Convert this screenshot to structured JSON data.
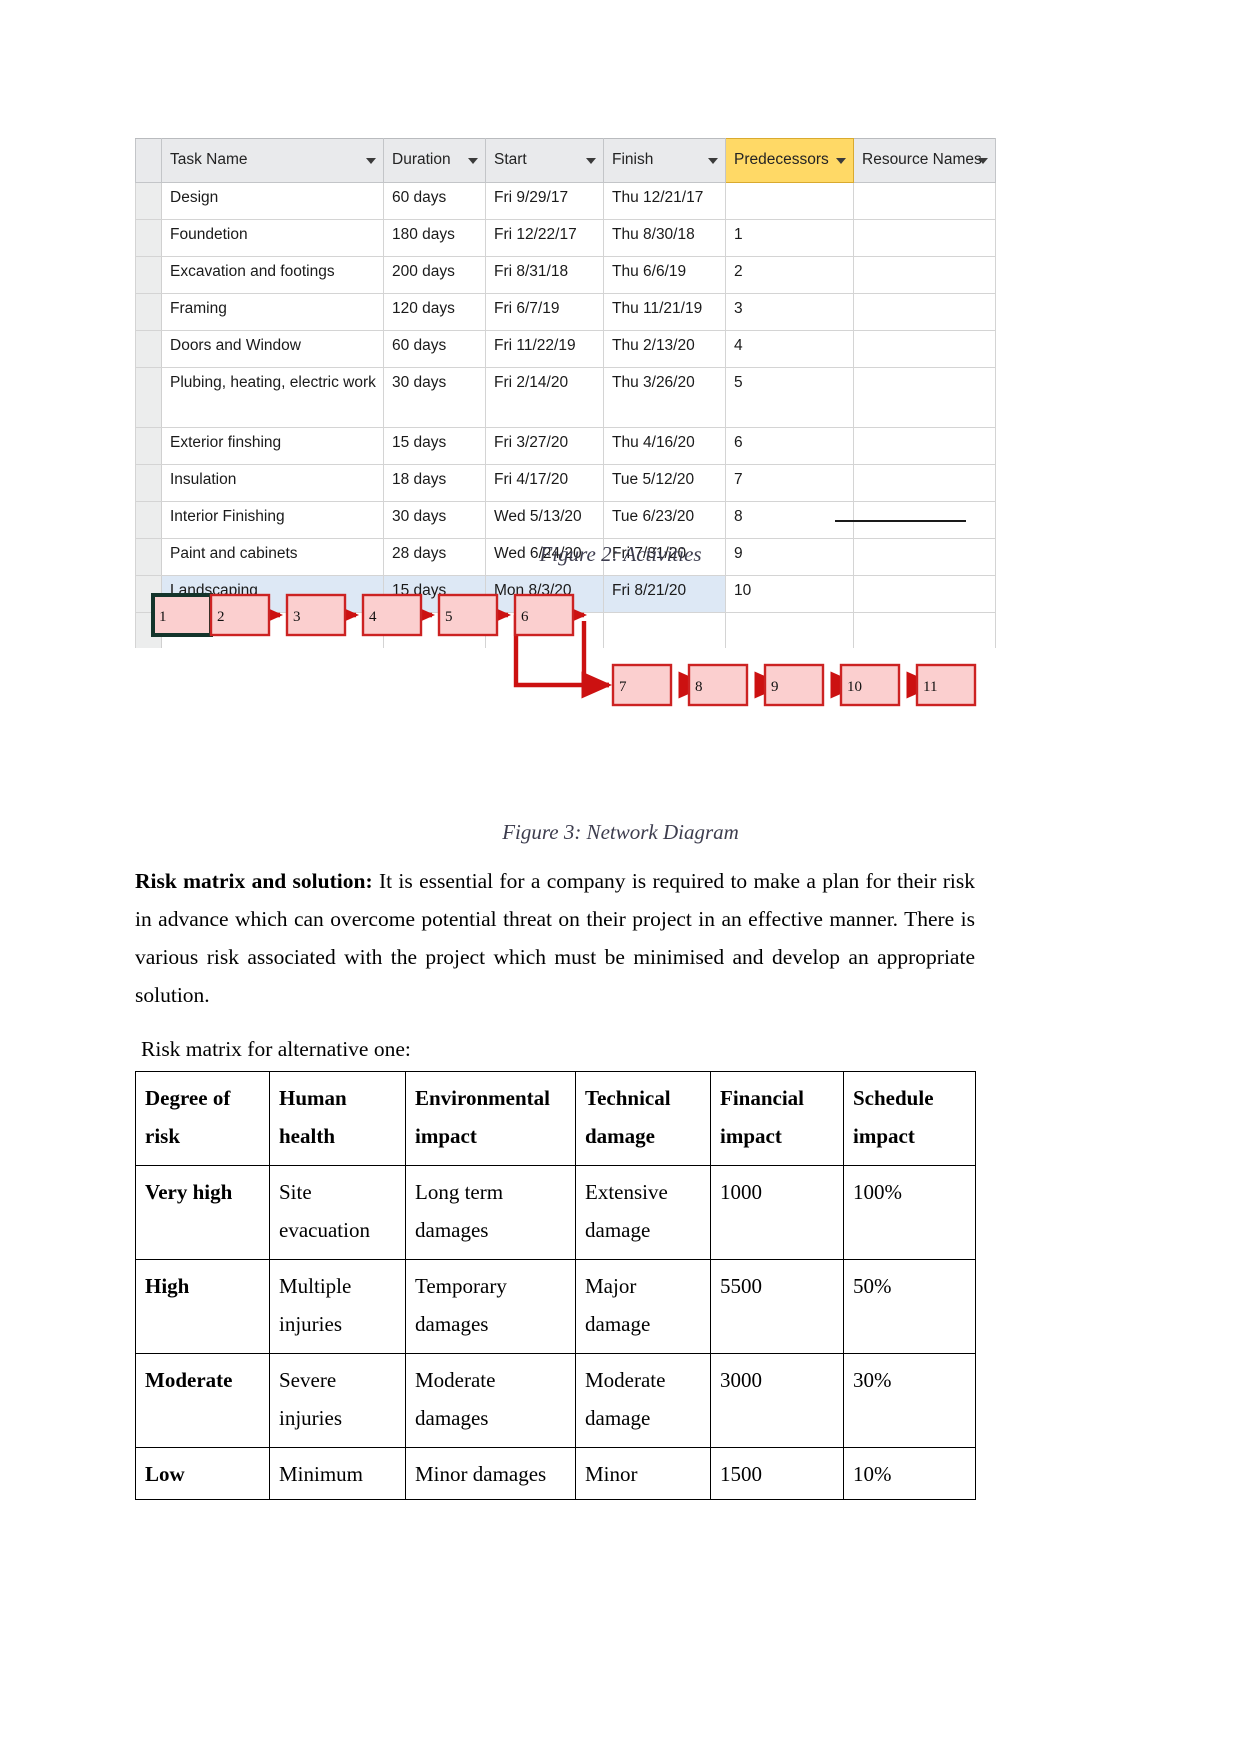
{
  "project_table": {
    "columns": [
      "Task Name",
      "Duration",
      "Start",
      "Finish",
      "Predecessors",
      "Resource Names"
    ],
    "highlight_column": "Predecessors",
    "highlight_color": "#ffd966",
    "rows": [
      {
        "task": "Design",
        "duration": "60 days",
        "start": "Fri 9/29/17",
        "finish": "Thu 12/21/17",
        "predecessors": "",
        "resources": ""
      },
      {
        "task": "Foundetion",
        "duration": "180 days",
        "start": "Fri 12/22/17",
        "finish": "Thu 8/30/18",
        "predecessors": "1",
        "resources": ""
      },
      {
        "task": "Excavation and footings",
        "duration": "200 days",
        "start": "Fri 8/31/18",
        "finish": "Thu 6/6/19",
        "predecessors": "2",
        "resources": ""
      },
      {
        "task": "Framing",
        "duration": "120 days",
        "start": "Fri 6/7/19",
        "finish": "Thu 11/21/19",
        "predecessors": "3",
        "resources": ""
      },
      {
        "task": "Doors and Window",
        "duration": "60 days",
        "start": "Fri 11/22/19",
        "finish": "Thu 2/13/20",
        "predecessors": "4",
        "resources": ""
      },
      {
        "task": "Plubing, heating, electric work",
        "duration": "30 days",
        "start": "Fri 2/14/20",
        "finish": "Thu 3/26/20",
        "predecessors": "5",
        "resources": ""
      },
      {
        "task": "Exterior finshing",
        "duration": "15 days",
        "start": "Fri 3/27/20",
        "finish": "Thu 4/16/20",
        "predecessors": "6",
        "resources": ""
      },
      {
        "task": "Insulation",
        "duration": "18 days",
        "start": "Fri 4/17/20",
        "finish": "Tue 5/12/20",
        "predecessors": "7",
        "resources": ""
      },
      {
        "task": "Interior Finishing",
        "duration": "30 days",
        "start": "Wed 5/13/20",
        "finish": "Tue 6/23/20",
        "predecessors": "8",
        "resources": ""
      },
      {
        "task": "Paint and cabinets",
        "duration": "28 days",
        "start": "Wed 6/24/20",
        "finish": "Fri 7/31/20",
        "predecessors": "9",
        "resources": ""
      },
      {
        "task": "Landscaping",
        "duration": "15 days",
        "start": "Mon 8/3/20",
        "finish": "Fri 8/21/20",
        "predecessors": "10",
        "resources": ""
      }
    ]
  },
  "figure2": {
    "caption": "Figure 2: Activities"
  },
  "figure3": {
    "caption": "Figure 3: Network Diagram",
    "nodes": [
      "1",
      "2",
      "3",
      "4",
      "5",
      "6",
      "7",
      "8",
      "9",
      "10",
      "11"
    ],
    "node_fill": "#fbcfcf",
    "node_stroke": "#cc2222",
    "start_node_stroke": "#14342b",
    "connector_color": "#cc1111"
  },
  "paragraphs": {
    "risk_heading": "Risk matrix and solution:",
    "risk_body": " It is essential for a company is required to make a plan for their risk in advance which can overcome potential threat on their project in an effective manner. There is various risk associated with the project which must be minimised and develop an appropriate solution.",
    "risk_matrix_label": "Risk matrix for alternative one:"
  },
  "risk_matrix": {
    "columns": [
      "Degree of risk",
      "Human health",
      "Environmental impact",
      "Technical damage",
      "Financial impact",
      "Schedule impact"
    ],
    "rows": [
      {
        "degree": "Very high",
        "human_health": "Site evacuation",
        "environmental_impact": "Long term damages",
        "technical_damage": "Extensive damage",
        "financial_impact": "1000",
        "schedule_impact": "100%"
      },
      {
        "degree": "High",
        "human_health": "Multiple injuries",
        "environmental_impact": "Temporary damages",
        "technical_damage": "Major damage",
        "financial_impact": "5500",
        "schedule_impact": "50%"
      },
      {
        "degree": "Moderate",
        "human_health": "Severe injuries",
        "environmental_impact": "Moderate damages",
        "technical_damage": "Moderate damage",
        "financial_impact": "3000",
        "schedule_impact": "30%"
      },
      {
        "degree": "Low",
        "human_health": "Minimum",
        "environmental_impact": "Minor damages",
        "technical_damage": "Minor",
        "financial_impact": "1500",
        "schedule_impact": "10%"
      }
    ]
  }
}
